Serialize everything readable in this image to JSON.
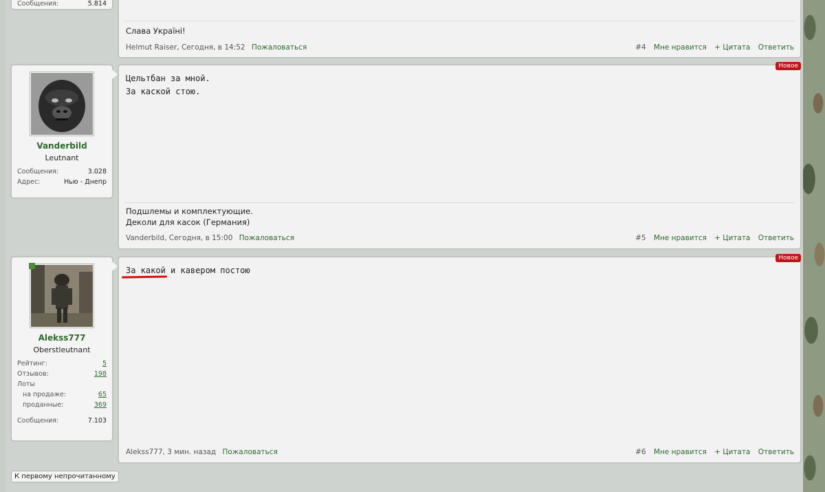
{
  "top_user": {
    "stat_label": "Сообщения:",
    "stat_value": "5.814"
  },
  "post4": {
    "signature": "Слава Україні!",
    "author_time": "Helmut Raiser, Сегодня, в 14:52",
    "report": "Пожаловаться",
    "num": "#4",
    "like": "Мне нравится",
    "quote": "+ Цитата",
    "reply": "Ответить"
  },
  "user5": {
    "name": "Vanderbild",
    "rank": "Leutnant",
    "messages_label": "Сообщения:",
    "messages_value": "3.028",
    "address_label": "Адрес:",
    "address_value": "Нью - Днепр"
  },
  "post5": {
    "badge": "Новое",
    "line1": "Цельтбан за мной.",
    "line2": "За каской стою.",
    "sig1": "Подшлемы и комплектующие.",
    "sig2": "Деколи для касок (Германия)",
    "author_time": "Vanderbild, Сегодня, в 15:00",
    "report": "Пожаловаться",
    "num": "#5",
    "like": "Мне нравится",
    "quote": "+ Цитата",
    "reply": "Ответить"
  },
  "user6": {
    "name": "Alekss777",
    "rank": "Oberstleutnant",
    "rating_label": "Рейтинг:",
    "rating_value": "5",
    "reviews_label": "Отзывов:",
    "reviews_value": "198",
    "lots_label": "Лоты",
    "sale_label": "на продаже:",
    "sale_value": "65",
    "sold_label": "проданные:",
    "sold_value": "369",
    "messages_label": "Сообщения:",
    "messages_value": "7.103"
  },
  "post6": {
    "badge": "Новое",
    "line1": "За какой и кавером постою",
    "author_time": "Alekss777, 3 мин. назад",
    "report": "Пожаловаться",
    "num": "#6",
    "like": "Мне нравится",
    "quote": "+ Цитата",
    "reply": "Ответить"
  },
  "first_unread": "К первому непрочитанному"
}
